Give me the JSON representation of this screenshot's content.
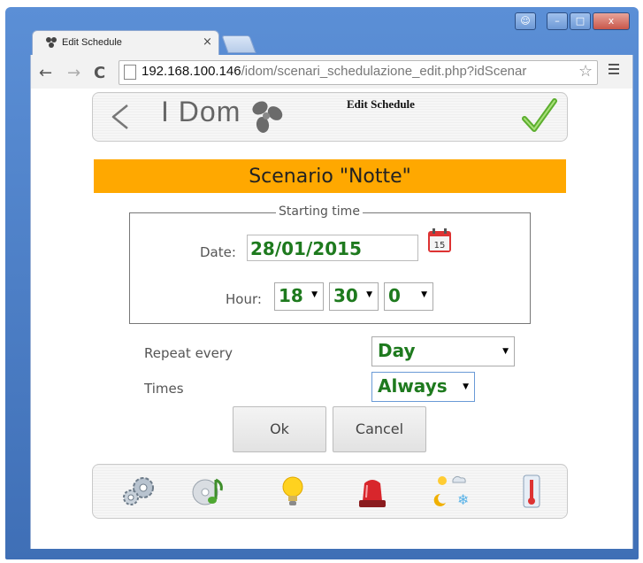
{
  "browser": {
    "tab_title": "Edit Schedule",
    "tab_close": "×",
    "url_host": "192.168.100.146",
    "url_path": "/idom/scenari_schedulazione_edit.php?idScenar",
    "back": "←",
    "forward": "→",
    "reload": "C",
    "star": "☆"
  },
  "header": {
    "logo": "I Dom",
    "title": "Edit Schedule"
  },
  "scenario": {
    "title": "Scenario \"Notte\""
  },
  "starting_time": {
    "legend": "Starting time",
    "date_label": "Date:",
    "date_value": "28/01/2015",
    "hour_label": "Hour:",
    "hour_value": "18",
    "minute_value": "30",
    "second_value": "0"
  },
  "repeat": {
    "label": "Repeat every",
    "value": "Day"
  },
  "times": {
    "label": "Times",
    "value": "Always"
  },
  "buttons": {
    "ok": "Ok",
    "cancel": "Cancel"
  },
  "colors": {
    "banner": "#ffa800",
    "select_value": "#1e7a1e"
  },
  "footer_icons": [
    "gears-icon",
    "music-icon",
    "lightbulb-icon",
    "alarm-siren-icon",
    "weather-icon",
    "thermometer-icon"
  ]
}
